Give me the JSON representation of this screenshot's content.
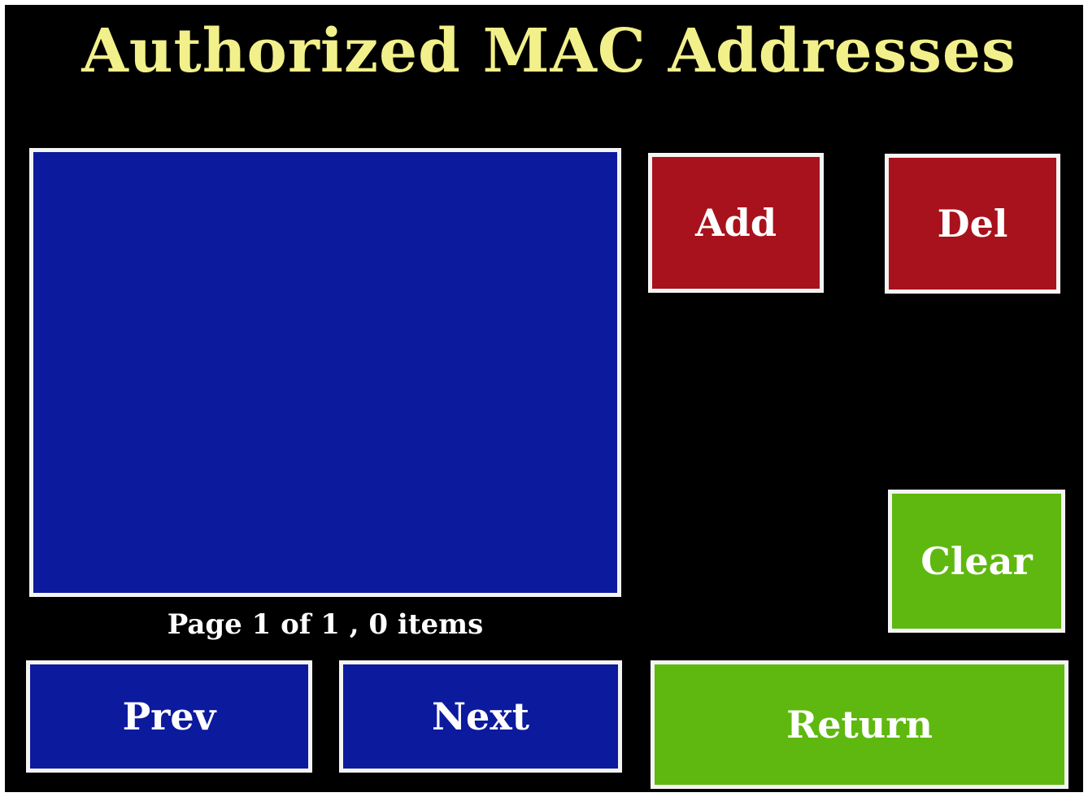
{
  "header": {
    "title": "Authorized MAC Addresses"
  },
  "list": {
    "items": [],
    "status": "Page 1 of 1 , 0 items"
  },
  "actions": {
    "add_label": "Add",
    "del_label": "Del",
    "clear_label": "Clear",
    "return_label": "Return"
  },
  "pagination": {
    "prev_label": "Prev",
    "next_label": "Next",
    "current_page": 1,
    "total_pages": 1,
    "item_count": 0
  },
  "colors": {
    "title": "#f2f08a",
    "list_background": "#0c1a9e",
    "danger_button": "#a8121c",
    "nav_button": "#0c1a9e",
    "confirm_button": "#5fb80f",
    "border": "#f4f4f4"
  }
}
